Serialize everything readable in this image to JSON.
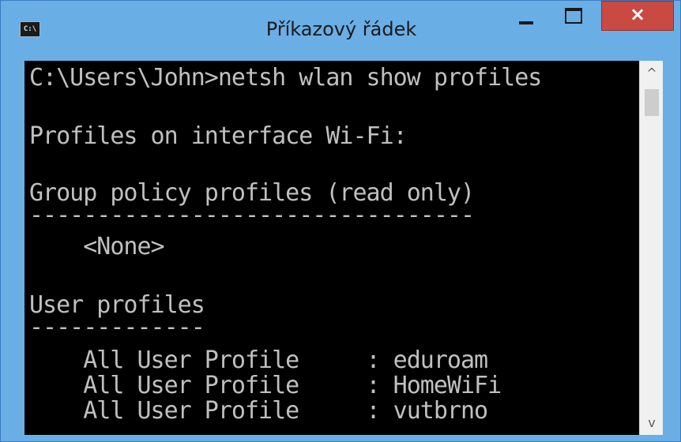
{
  "window": {
    "title": "Příkazový řádek",
    "icon_label": "C:\\",
    "close_symbol": "×"
  },
  "console": {
    "lines": [
      "C:\\Users\\John>netsh wlan show profiles",
      "Profiles on interface Wi-Fi:",
      "Group policy profiles (read only)",
      "---------------------------------",
      "    <None>",
      "User profiles",
      "-------------",
      "    All User Profile     : eduroam",
      "    All User Profile     : HomeWiFi",
      "    All User Profile     : vutbrno"
    ]
  },
  "scrollbar": {
    "up_arrow": "^",
    "down_arrow": "v"
  },
  "colors": {
    "titlebar": "#6aaee6",
    "close": "#c94a43",
    "console_bg": "#000000",
    "console_text": "#c0c0c0"
  }
}
